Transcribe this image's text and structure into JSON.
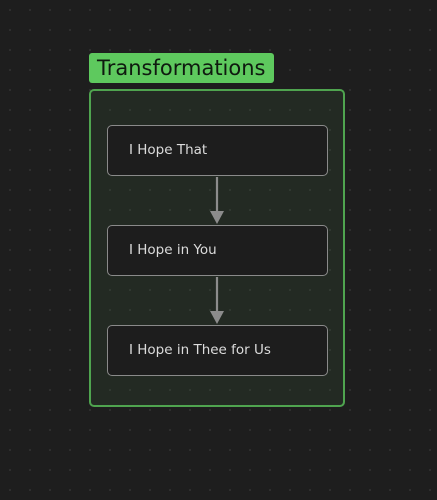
{
  "group": {
    "title": "Transformations",
    "color": "#5ec95e"
  },
  "nodes": [
    {
      "label": "I Hope That"
    },
    {
      "label": "I Hope in You"
    },
    {
      "label": "I Hope in Thee for Us"
    }
  ],
  "edges": [
    {
      "from": 0,
      "to": 1
    },
    {
      "from": 1,
      "to": 2
    }
  ]
}
